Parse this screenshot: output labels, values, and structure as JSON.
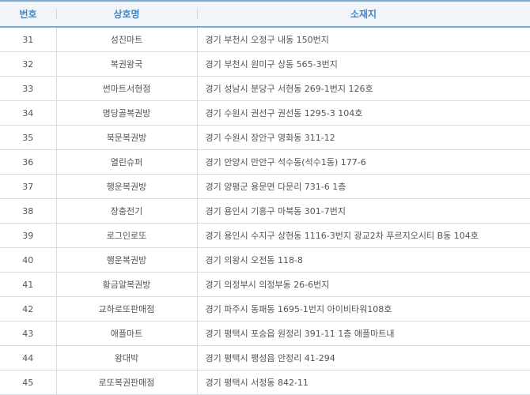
{
  "table": {
    "headers": [
      "번호",
      "상호명",
      "소재지"
    ],
    "rows": [
      [
        "31",
        "성진마트",
        "경기 부천시 오정구 내동 150번지"
      ],
      [
        "32",
        "복권왕국",
        "경기 부천시 원미구 상동 565-3번지"
      ],
      [
        "33",
        "썬마트서현점",
        "경기 성남시 분당구 서현동 269-1번지 126호"
      ],
      [
        "34",
        "명당골복권방",
        "경기 수원시 권선구 권선동 1295-3 104호"
      ],
      [
        "35",
        "북문복권방",
        "경기 수원시 장안구 영화동 311-12"
      ],
      [
        "36",
        "열린슈퍼",
        "경기 안양시 만안구 석수동(석수1동) 177-6"
      ],
      [
        "37",
        "행운복권방",
        "경기 양평군 용문면 다문리 731-6 1층"
      ],
      [
        "38",
        "장충전기",
        "경기 용인시 기흥구 마북동 301-7번지"
      ],
      [
        "39",
        "로그인로또",
        "경기 용인시 수지구 상현동 1116-3번지 광교2차 푸르지오시티 B동 104호"
      ],
      [
        "40",
        "행운복권방",
        "경기 의왕시 오전동 118-8"
      ],
      [
        "41",
        "황금알복권방",
        "경기 의정부시 의정부동 26-6번지"
      ],
      [
        "42",
        "교하로또판매점",
        "경기 파주시 동패동 1695-1번지 아이비타워108호"
      ],
      [
        "43",
        "애플마트",
        "경기 평택시 포승읍 원정리 391-11 1층 애플마트내"
      ],
      [
        "44",
        "왕대박",
        "경기 평택시 팽성읍 안정리 41-294"
      ],
      [
        "45",
        "로또복권판매점",
        "경기 평택시 서정동 842-11"
      ]
    ]
  }
}
